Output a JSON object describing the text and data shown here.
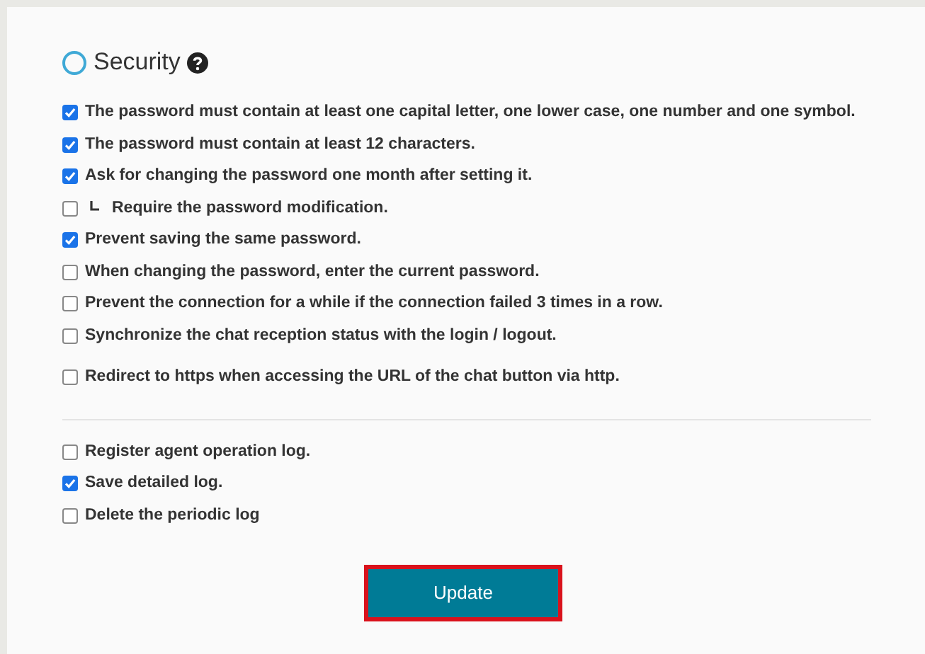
{
  "section": {
    "title": "Security"
  },
  "groups": [
    {
      "items": [
        {
          "label": "The password must contain at least one capital letter, one lower case, one number and one symbol.",
          "checked": true,
          "kind": "plain"
        },
        {
          "label": "The password must contain at least 12 characters.",
          "checked": true,
          "kind": "plain"
        },
        {
          "label": "Ask for changing the password one month after setting it.",
          "checked": true,
          "kind": "plain"
        },
        {
          "label": "Require the password modification.",
          "checked": false,
          "kind": "sub"
        },
        {
          "label": "Prevent saving the same password.",
          "checked": true,
          "kind": "plain"
        },
        {
          "label": "When changing the password, enter the current password.",
          "checked": false,
          "kind": "plain"
        },
        {
          "label": "Prevent the connection for a while if the connection failed 3 times in a row.",
          "checked": false,
          "kind": "plain"
        },
        {
          "label": "Synchronize the chat reception status with the login / logout.",
          "checked": false,
          "kind": "plain"
        }
      ]
    },
    {
      "items": [
        {
          "label": "Redirect to https when accessing the URL of the chat button via http.",
          "checked": false,
          "kind": "plain"
        }
      ]
    },
    {
      "items": [
        {
          "label": "Register agent operation log.",
          "checked": false,
          "kind": "plain"
        },
        {
          "label": "Save detailed log.",
          "checked": true,
          "kind": "plain"
        },
        {
          "label": "Delete the periodic log",
          "checked": false,
          "kind": "plain"
        }
      ]
    }
  ],
  "button": {
    "label": "Update"
  }
}
